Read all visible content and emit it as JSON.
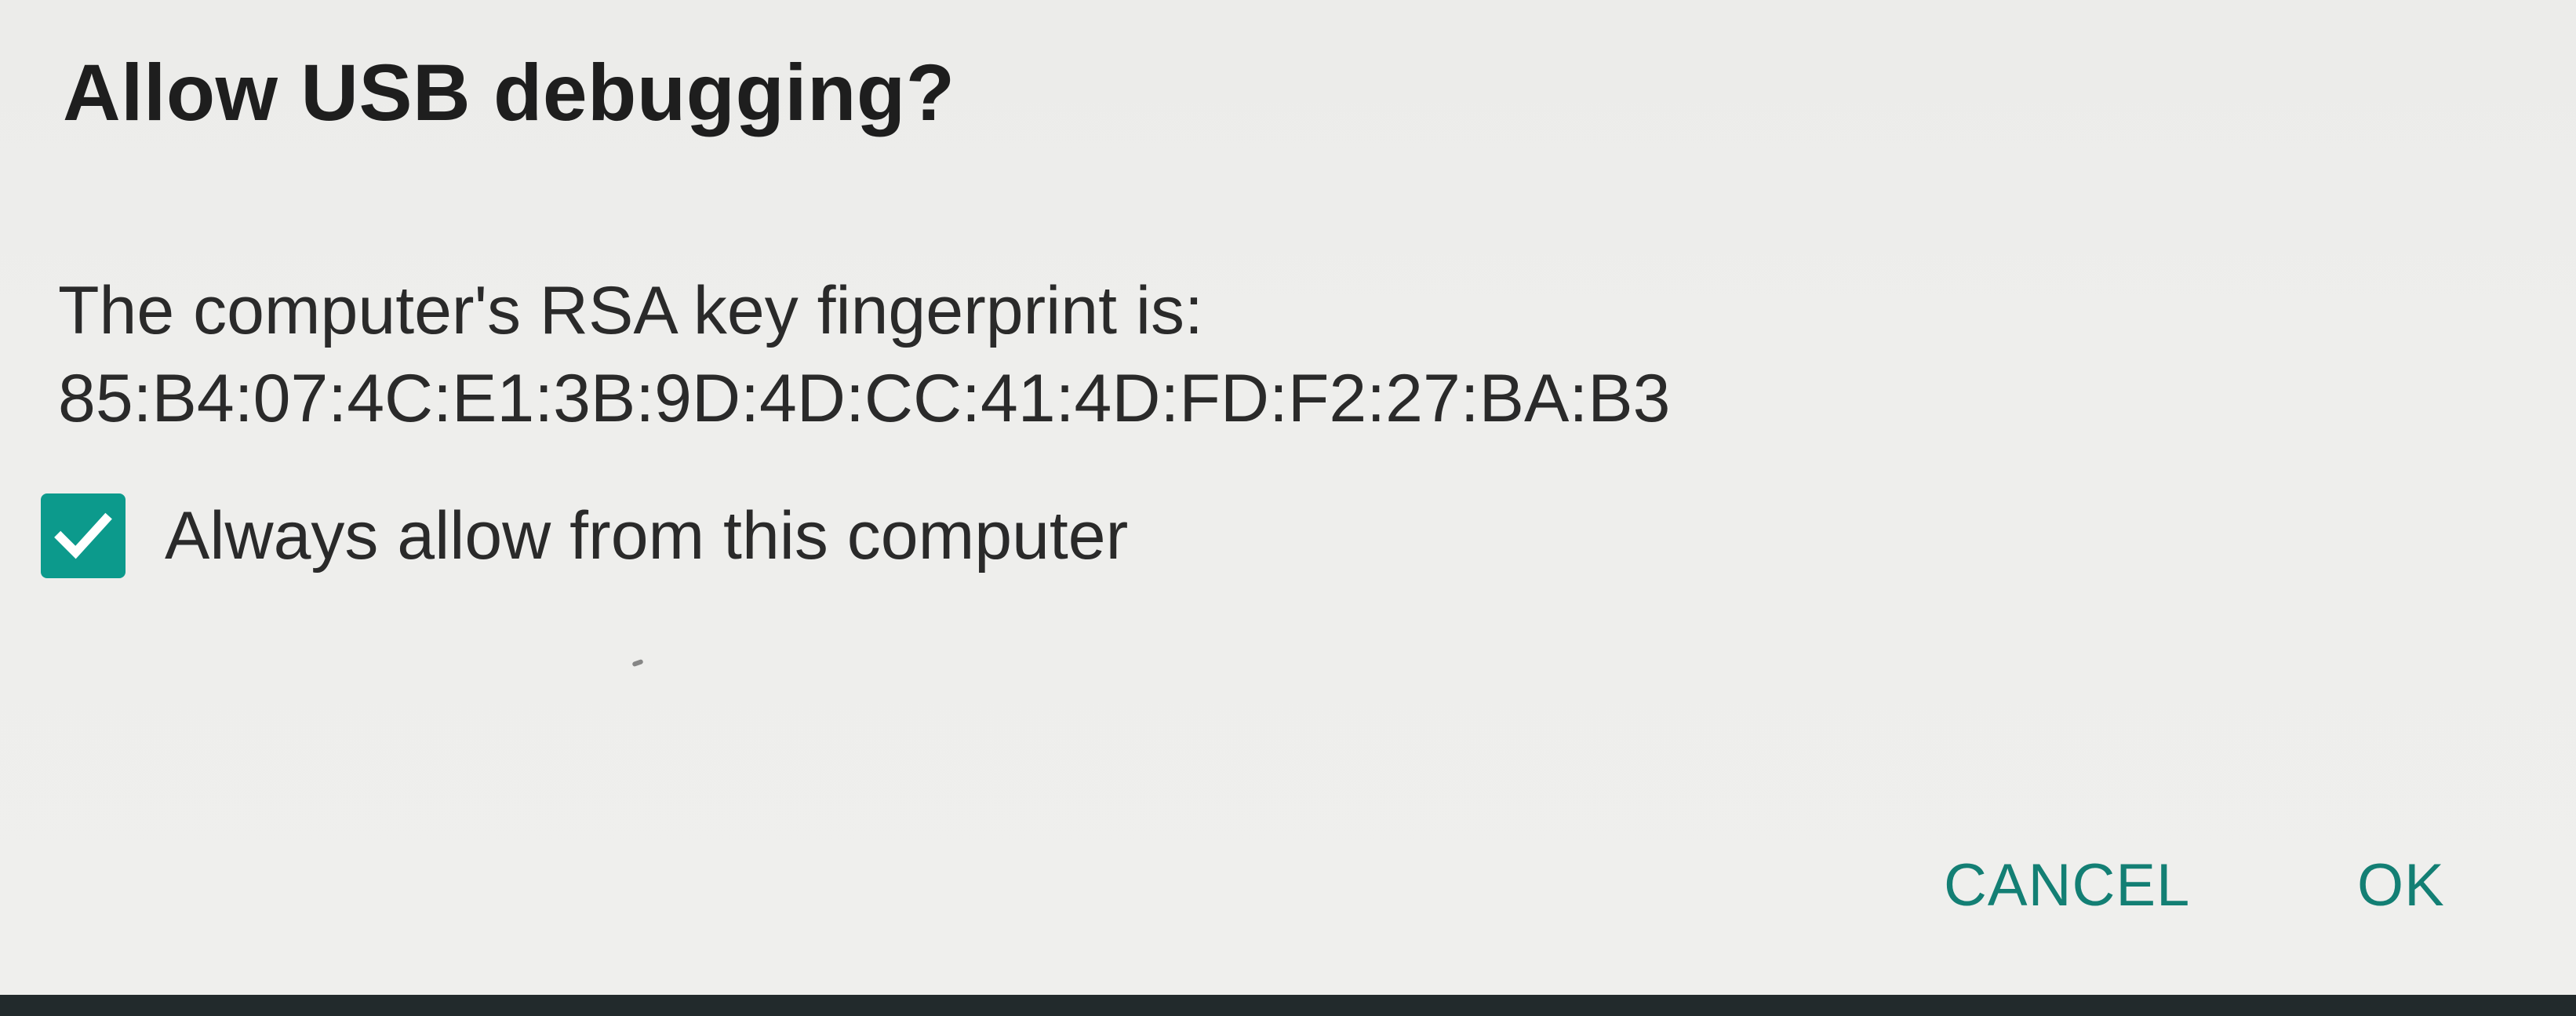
{
  "dialog": {
    "title": "Allow USB debugging?",
    "message_line1": "The computer's RSA key fingerprint is:",
    "fingerprint": "85:B4:07:4C:E1:3B:9D:4D:CC:41:4D:FD:F2:27:BA:B3",
    "checkbox": {
      "label": "Always allow from this computer",
      "checked": true,
      "icon": "checkmark-icon"
    },
    "buttons": {
      "cancel_label": "CANCEL",
      "ok_label": "OK"
    }
  },
  "colors": {
    "accent": "#0c9a8c",
    "button_text": "#137f74",
    "background": "#eeeeec",
    "title_text": "#1e1e1e"
  }
}
